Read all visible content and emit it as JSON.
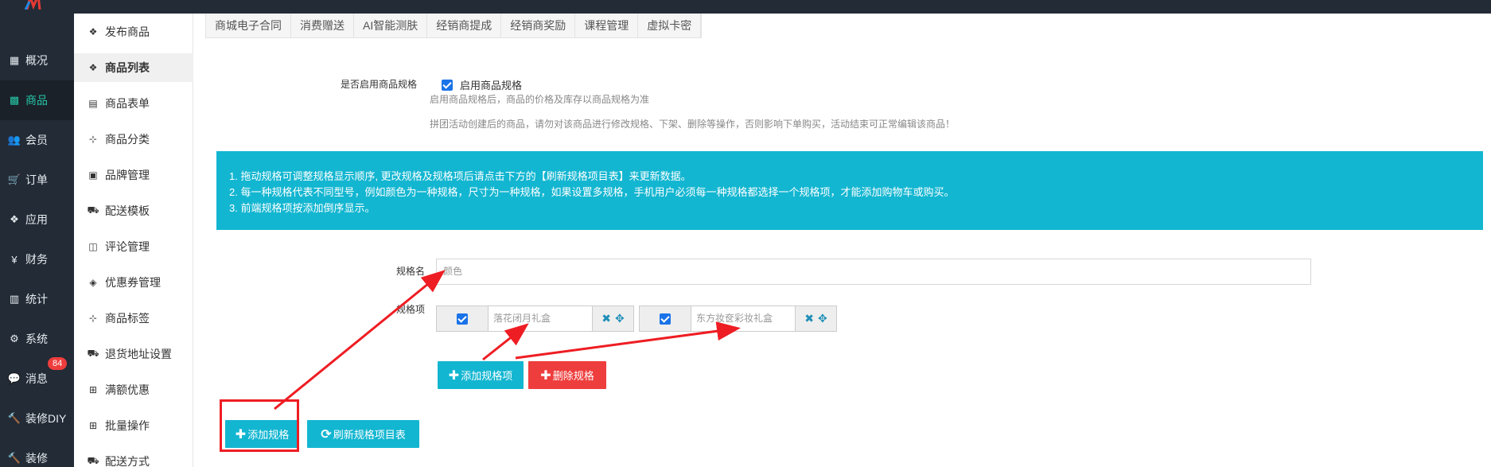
{
  "sidebar": {
    "items": [
      {
        "label": "概况",
        "icon": "dashboard-icon",
        "glyph": "▦"
      },
      {
        "label": "商品",
        "icon": "goods-icon",
        "glyph": "▩"
      },
      {
        "label": "会员",
        "icon": "users-icon",
        "glyph": "👥"
      },
      {
        "label": "订单",
        "icon": "cart-icon",
        "glyph": "🛒"
      },
      {
        "label": "应用",
        "icon": "cubes-icon",
        "glyph": "❖"
      },
      {
        "label": "财务",
        "icon": "yen-icon",
        "glyph": "¥"
      },
      {
        "label": "统计",
        "icon": "bar-chart-icon",
        "glyph": "▥"
      },
      {
        "label": "系统",
        "icon": "gears-icon",
        "glyph": "⚙"
      },
      {
        "label": "消息",
        "icon": "comment-icon",
        "glyph": "💬"
      },
      {
        "label": "装修DIY",
        "icon": "gavel-icon",
        "glyph": "🔨"
      },
      {
        "label": "装修",
        "icon": "gavel-icon",
        "glyph": "🔨"
      }
    ],
    "message_badge": "84"
  },
  "submenu": {
    "items": [
      {
        "label": "发布商品",
        "icon": "cubes-icon",
        "glyph": "❖"
      },
      {
        "label": "商品列表",
        "icon": "cubes-icon",
        "glyph": "❖"
      },
      {
        "label": "商品表单",
        "icon": "form-icon",
        "glyph": "▤"
      },
      {
        "label": "商品分类",
        "icon": "sitemap-icon",
        "glyph": "⊹"
      },
      {
        "label": "品牌管理",
        "icon": "briefcase-icon",
        "glyph": "▣"
      },
      {
        "label": "配送模板",
        "icon": "truck-icon",
        "glyph": "⛟"
      },
      {
        "label": "评论管理",
        "icon": "window-icon",
        "glyph": "◫"
      },
      {
        "label": "优惠券管理",
        "icon": "tags-icon",
        "glyph": "◈"
      },
      {
        "label": "商品标签",
        "icon": "sitemap-icon",
        "glyph": "⊹"
      },
      {
        "label": "退货地址设置",
        "icon": "truck-icon",
        "glyph": "⛟"
      },
      {
        "label": "满额优惠",
        "icon": "gift-icon",
        "glyph": "⊞"
      },
      {
        "label": "批量操作",
        "icon": "gift-icon",
        "glyph": "⊞"
      },
      {
        "label": "配送方式",
        "icon": "truck-icon",
        "glyph": "⛟"
      }
    ]
  },
  "tabs": [
    "商城电子合同",
    "消费赠送",
    "AI智能测肤",
    "经销商提成",
    "经销商奖励",
    "课程管理",
    "虚拟卡密"
  ],
  "spec_enable": {
    "label": "是否启用商品规格",
    "checkbox_label": "启用商品规格",
    "hint": "启用商品规格后，商品的价格及库存以商品规格为准",
    "warning": "拼团活动创建后的商品，请勿对该商品进行修改规格、下架、删除等操作，否则影响下单购买，活动结束可正常编辑该商品！"
  },
  "info": {
    "lines": [
      "1. 拖动规格可调整规格显示顺序, 更改规格及规格项后请点击下方的【刷新规格项目表】来更新数据。",
      "2. 每一种规格代表不同型号，例如颜色为一种规格，尺寸为一种规格，如果设置多规格，手机用户必须每一种规格都选择一个规格项，才能添加购物车或购买。",
      "3. 前端规格项按添加倒序显示。"
    ]
  },
  "spec": {
    "name_label": "规格名",
    "name_placeholder": "颜色",
    "items_label": "规格项",
    "items": [
      {
        "value": "落花闭月礼盒"
      },
      {
        "value": "东方妆奁彩妆礼盒"
      }
    ]
  },
  "buttons": {
    "add_item": "添加规格项",
    "delete_spec": "删除规格",
    "add_spec": "添加规格",
    "refresh_table": "刷新规格项目表"
  },
  "colors": {
    "sidebar_bg": "#222b36",
    "accent_green": "#26c6a6",
    "info_bg": "#13b6d1",
    "danger": "#ee3d3d",
    "annotation_red": "#ee1d23"
  }
}
